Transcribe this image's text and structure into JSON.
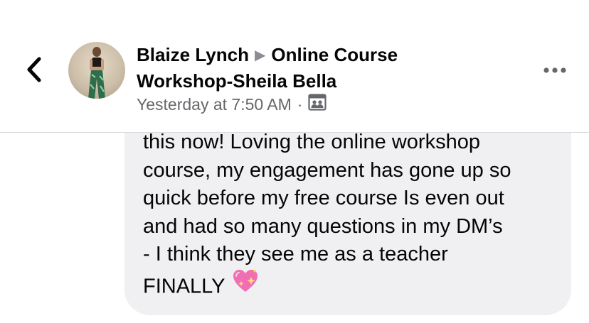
{
  "header": {
    "author": "Blaize Lynch",
    "group_line1": "Online Course",
    "group_line2": "Workshop-Sheila Bella",
    "timestamp": "Yesterday at 7:50 AM",
    "separator": "·",
    "privacy_icon": "group-members-icon",
    "back_icon": "chevron-left-icon",
    "more_icon": "more-dots-icon"
  },
  "message": {
    "lines": [
      "this now! Loving the online workshop",
      "course, my engagement has gone up so",
      "quick before my free course Is even out",
      "and had so many questions in my DM’s",
      "- I think they see me as a teacher",
      "FINALLY"
    ],
    "emoji": "sparkling-heart-icon"
  },
  "colors": {
    "bubble": "#f0f0f2",
    "secondary_text": "#65676b",
    "primary_text": "#050505"
  }
}
